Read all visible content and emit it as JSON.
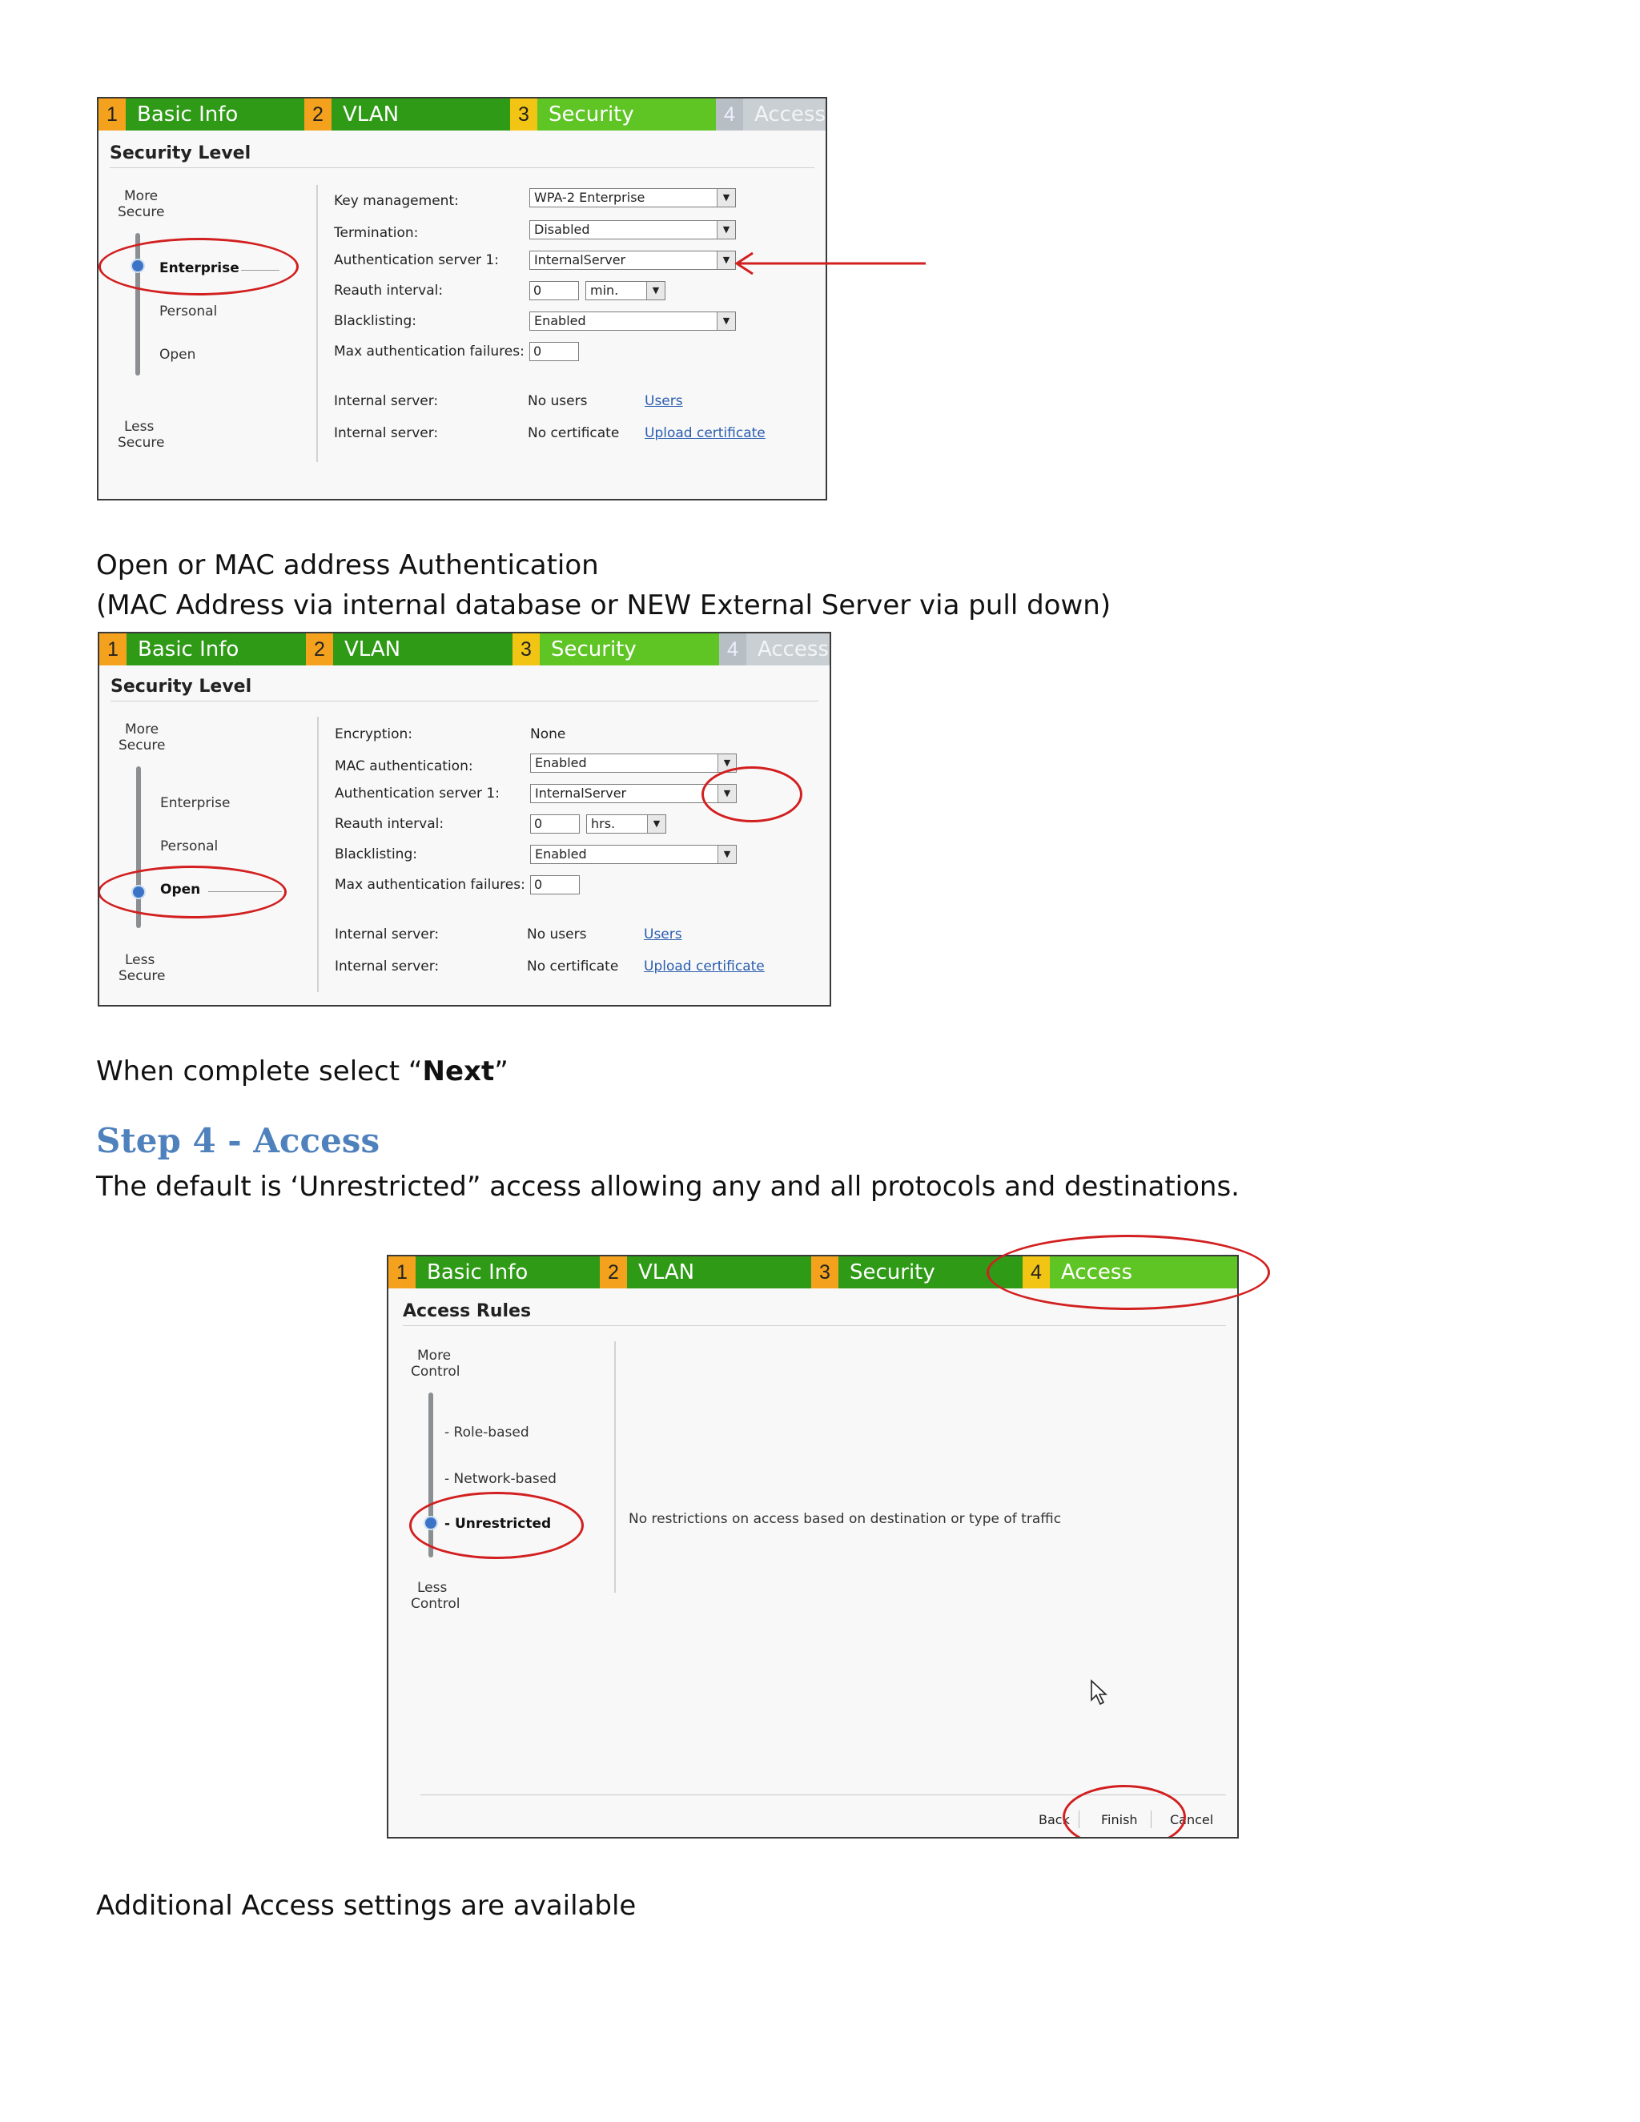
{
  "wizard_tabs": [
    {
      "num": "1",
      "label": "Basic Info"
    },
    {
      "num": "2",
      "label": "VLAN"
    },
    {
      "num": "3",
      "label": "Security"
    },
    {
      "num": "4",
      "label": "Access"
    }
  ],
  "shot1": {
    "section_title": "Security Level",
    "more_secure": [
      "More",
      "Secure"
    ],
    "less_secure": [
      "Less",
      "Secure"
    ],
    "levels": {
      "enterprise": "Enterprise",
      "personal": "Personal",
      "open": "Open"
    },
    "fields": {
      "key_management_label": "Key management:",
      "key_management_value": "WPA-2 Enterprise",
      "termination_label": "Termination:",
      "termination_value": "Disabled",
      "auth_server_label": "Authentication server 1:",
      "auth_server_value": "InternalServer",
      "reauth_label": "Reauth interval:",
      "reauth_value": "0",
      "reauth_unit": "min.",
      "blacklisting_label": "Blacklisting:",
      "blacklisting_value": "Enabled",
      "max_fail_label": "Max authentication failures:",
      "max_fail_value": "0",
      "internal_server_label_1": "Internal server:",
      "internal_server_value_1": "No users",
      "internal_server_link_1": "Users",
      "internal_server_label_2": "Internal server:",
      "internal_server_value_2": "No certificate",
      "internal_server_link_2": "Upload certificate"
    }
  },
  "text": {
    "para_open_1": "Open or MAC address Authentication",
    "para_open_2": "(MAC Address via internal database or NEW External Server via pull down)",
    "next_prefix": "When complete select “",
    "next_bold": "Next",
    "next_suffix": "”",
    "step4_heading": "Step 4 - Access",
    "step4_desc": "The default is ‘Unrestricted” access allowing any and all protocols and destinations.",
    "additional": "Additional Access settings are available"
  },
  "shot2": {
    "section_title": "Security Level",
    "more_secure": [
      "More",
      "Secure"
    ],
    "less_secure": [
      "Less",
      "Secure"
    ],
    "levels": {
      "enterprise": "Enterprise",
      "personal": "Personal",
      "open": "Open"
    },
    "fields": {
      "encryption_label": "Encryption:",
      "encryption_value": "None",
      "mac_auth_label": "MAC authentication:",
      "mac_auth_value": "Enabled",
      "auth_server_label": "Authentication server 1:",
      "auth_server_value": "InternalServer",
      "reauth_label": "Reauth interval:",
      "reauth_value": "0",
      "reauth_unit": "hrs.",
      "blacklisting_label": "Blacklisting:",
      "blacklisting_value": "Enabled",
      "max_fail_label": "Max authentication failures:",
      "max_fail_value": "0",
      "internal_server_label_1": "Internal server:",
      "internal_server_value_1": "No users",
      "internal_server_link_1": "Users",
      "internal_server_label_2": "Internal server:",
      "internal_server_value_2": "No certificate",
      "internal_server_link_2": "Upload certificate"
    }
  },
  "shot3": {
    "section_title": "Access Rules",
    "more_control": [
      "More",
      "Control"
    ],
    "less_control": [
      "Less",
      "Control"
    ],
    "levels": {
      "role": "- Role-based",
      "network": "- Network-based",
      "unrestricted": "- Unrestricted"
    },
    "description": "No restrictions on access based on destination or type of traffic",
    "buttons": {
      "back": "Back",
      "finish": "Finish",
      "cancel": "Cancel"
    }
  },
  "colors": {
    "annotation_red": "#d21f1f",
    "heading_blue": "#4f81bd",
    "tab_green": "#2e9a16",
    "tab_orange": "#f4a21d"
  }
}
